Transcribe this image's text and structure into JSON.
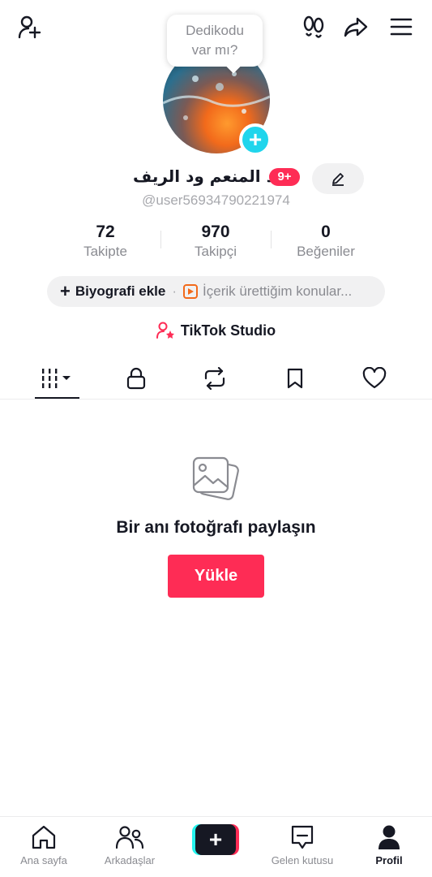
{
  "bubble": {
    "line1": "Dedikodu",
    "line2": "var mı?"
  },
  "profile": {
    "name": "عبد المنعم ود الريف",
    "notification_badge": "9+",
    "handle": "@user56934790221974"
  },
  "stats": [
    {
      "value": "72",
      "label": "Takipte"
    },
    {
      "value": "970",
      "label": "Takipçi"
    },
    {
      "value": "0",
      "label": "Beğeniler"
    }
  ],
  "bio": {
    "add_label": "Biyografi ekle",
    "separator": "·",
    "interest_label": "İçerik ürettiğim konular..."
  },
  "studio": {
    "label": "TikTok Studio"
  },
  "empty_state": {
    "title": "Bir anı fotoğrafı paylaşın",
    "button_label": "Yükle"
  },
  "bottom_nav": [
    {
      "label": "Ana sayfa"
    },
    {
      "label": "Arkadaşlar"
    },
    {
      "label": ""
    },
    {
      "label": "Gelen kutusu"
    },
    {
      "label": "Profil"
    }
  ],
  "colors": {
    "accent": "#fe2c55",
    "cyan": "#25f4ee",
    "avatar_add": "#20d5ec",
    "text": "#161823",
    "muted": "#8a8b91"
  },
  "icons": [
    "add-friend-icon",
    "footprints-icon",
    "share-icon",
    "menu-icon",
    "pencil-icon",
    "plus-icon",
    "play-square-icon",
    "studio-icon",
    "grid-icon",
    "lock-icon",
    "repost-icon",
    "bookmark-icon",
    "heart-icon",
    "photo-icon",
    "home-icon",
    "friends-icon",
    "create-icon",
    "inbox-icon",
    "profile-icon"
  ]
}
